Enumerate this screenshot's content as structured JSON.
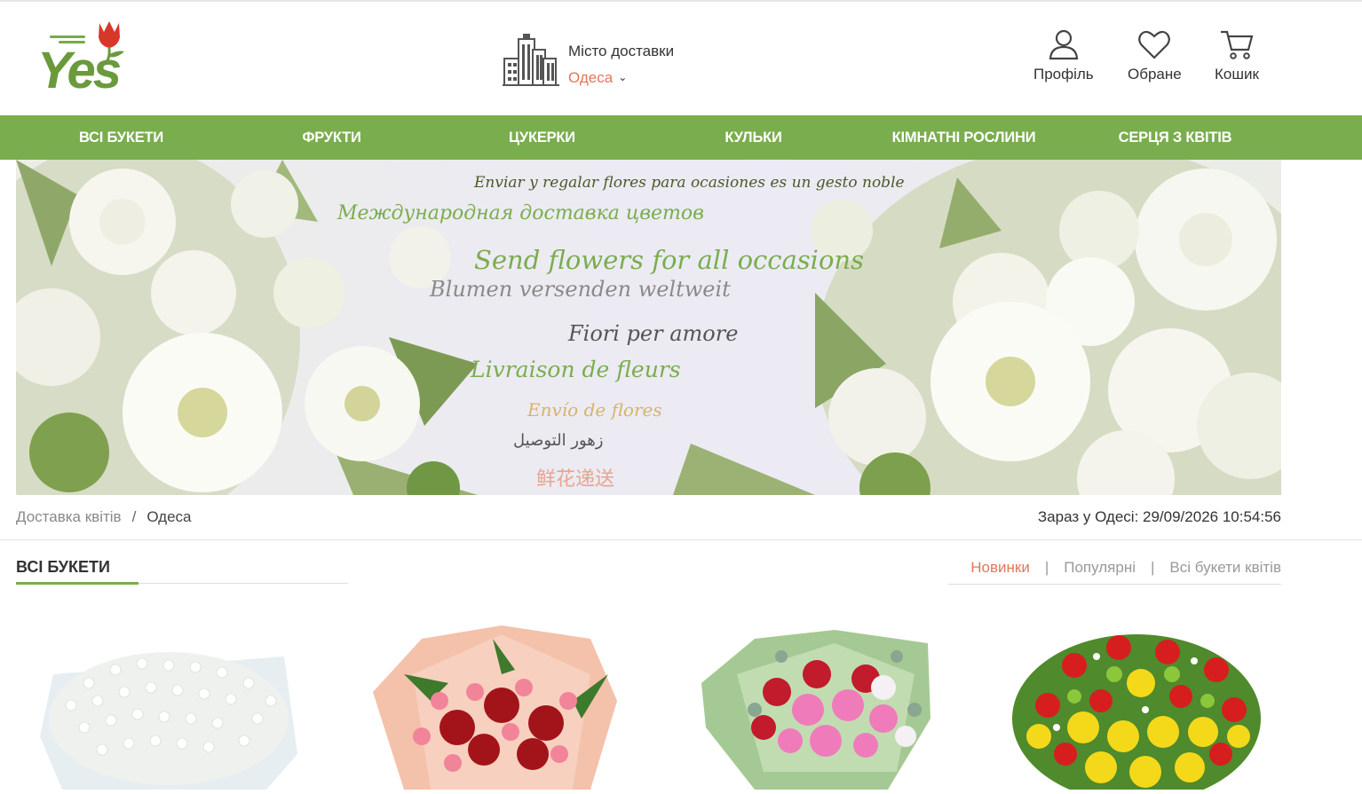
{
  "header": {
    "logo_text": "Yes",
    "city_label": "Місто доставки",
    "city_value": "Одеса",
    "profile_label": "Профіль",
    "favorites_label": "Обране",
    "cart_label": "Кошик"
  },
  "nav": {
    "items": [
      "ВСІ БУКЕТИ",
      "ФРУКТИ",
      "ЦУКЕРКИ",
      "КУЛЬКИ",
      "КІМНАТНІ РОСЛИНИ",
      "СЕРЦЯ З КВІТІВ"
    ]
  },
  "banner": {
    "lines": [
      "Enviar y regalar flores para ocasiones es un gesto noble",
      "Международная доставка цветов",
      "Send flowers for all occasions",
      "Blumen versenden weltweit",
      "Fiori per amore",
      "Livraison de fleurs",
      "Envío de flores",
      "زهور التوصيل",
      "鲜花递送"
    ]
  },
  "breadcrumb": {
    "home": "Доставка квітів",
    "separator": "/",
    "current": "Одеса"
  },
  "clock_text": "Зараз у Одесі: 29/09/2026 10:54:56",
  "section": {
    "title": "ВСІ БУКЕТИ",
    "tabs": [
      "Новинки",
      "Популярні",
      "Всі букети квітів"
    ],
    "tab_separator": "|"
  },
  "colors": {
    "brand_green": "#7aad4e",
    "accent_coral": "#e0775c"
  }
}
